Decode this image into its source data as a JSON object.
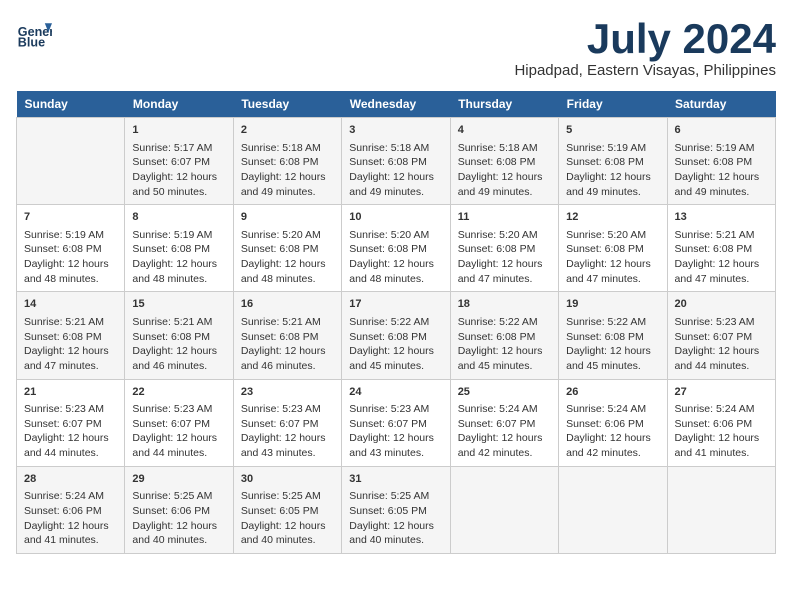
{
  "header": {
    "logo_line1": "General",
    "logo_line2": "Blue",
    "title": "July 2024",
    "subtitle": "Hipadpad, Eastern Visayas, Philippines"
  },
  "days_of_week": [
    "Sunday",
    "Monday",
    "Tuesday",
    "Wednesday",
    "Thursday",
    "Friday",
    "Saturday"
  ],
  "weeks": [
    [
      {
        "day": "",
        "content": ""
      },
      {
        "day": "1",
        "content": "Sunrise: 5:17 AM\nSunset: 6:07 PM\nDaylight: 12 hours\nand 50 minutes."
      },
      {
        "day": "2",
        "content": "Sunrise: 5:18 AM\nSunset: 6:08 PM\nDaylight: 12 hours\nand 49 minutes."
      },
      {
        "day": "3",
        "content": "Sunrise: 5:18 AM\nSunset: 6:08 PM\nDaylight: 12 hours\nand 49 minutes."
      },
      {
        "day": "4",
        "content": "Sunrise: 5:18 AM\nSunset: 6:08 PM\nDaylight: 12 hours\nand 49 minutes."
      },
      {
        "day": "5",
        "content": "Sunrise: 5:19 AM\nSunset: 6:08 PM\nDaylight: 12 hours\nand 49 minutes."
      },
      {
        "day": "6",
        "content": "Sunrise: 5:19 AM\nSunset: 6:08 PM\nDaylight: 12 hours\nand 49 minutes."
      }
    ],
    [
      {
        "day": "7",
        "content": "Sunrise: 5:19 AM\nSunset: 6:08 PM\nDaylight: 12 hours\nand 48 minutes."
      },
      {
        "day": "8",
        "content": "Sunrise: 5:19 AM\nSunset: 6:08 PM\nDaylight: 12 hours\nand 48 minutes."
      },
      {
        "day": "9",
        "content": "Sunrise: 5:20 AM\nSunset: 6:08 PM\nDaylight: 12 hours\nand 48 minutes."
      },
      {
        "day": "10",
        "content": "Sunrise: 5:20 AM\nSunset: 6:08 PM\nDaylight: 12 hours\nand 48 minutes."
      },
      {
        "day": "11",
        "content": "Sunrise: 5:20 AM\nSunset: 6:08 PM\nDaylight: 12 hours\nand 47 minutes."
      },
      {
        "day": "12",
        "content": "Sunrise: 5:20 AM\nSunset: 6:08 PM\nDaylight: 12 hours\nand 47 minutes."
      },
      {
        "day": "13",
        "content": "Sunrise: 5:21 AM\nSunset: 6:08 PM\nDaylight: 12 hours\nand 47 minutes."
      }
    ],
    [
      {
        "day": "14",
        "content": "Sunrise: 5:21 AM\nSunset: 6:08 PM\nDaylight: 12 hours\nand 47 minutes."
      },
      {
        "day": "15",
        "content": "Sunrise: 5:21 AM\nSunset: 6:08 PM\nDaylight: 12 hours\nand 46 minutes."
      },
      {
        "day": "16",
        "content": "Sunrise: 5:21 AM\nSunset: 6:08 PM\nDaylight: 12 hours\nand 46 minutes."
      },
      {
        "day": "17",
        "content": "Sunrise: 5:22 AM\nSunset: 6:08 PM\nDaylight: 12 hours\nand 45 minutes."
      },
      {
        "day": "18",
        "content": "Sunrise: 5:22 AM\nSunset: 6:08 PM\nDaylight: 12 hours\nand 45 minutes."
      },
      {
        "day": "19",
        "content": "Sunrise: 5:22 AM\nSunset: 6:08 PM\nDaylight: 12 hours\nand 45 minutes."
      },
      {
        "day": "20",
        "content": "Sunrise: 5:23 AM\nSunset: 6:07 PM\nDaylight: 12 hours\nand 44 minutes."
      }
    ],
    [
      {
        "day": "21",
        "content": "Sunrise: 5:23 AM\nSunset: 6:07 PM\nDaylight: 12 hours\nand 44 minutes."
      },
      {
        "day": "22",
        "content": "Sunrise: 5:23 AM\nSunset: 6:07 PM\nDaylight: 12 hours\nand 44 minutes."
      },
      {
        "day": "23",
        "content": "Sunrise: 5:23 AM\nSunset: 6:07 PM\nDaylight: 12 hours\nand 43 minutes."
      },
      {
        "day": "24",
        "content": "Sunrise: 5:23 AM\nSunset: 6:07 PM\nDaylight: 12 hours\nand 43 minutes."
      },
      {
        "day": "25",
        "content": "Sunrise: 5:24 AM\nSunset: 6:07 PM\nDaylight: 12 hours\nand 42 minutes."
      },
      {
        "day": "26",
        "content": "Sunrise: 5:24 AM\nSunset: 6:06 PM\nDaylight: 12 hours\nand 42 minutes."
      },
      {
        "day": "27",
        "content": "Sunrise: 5:24 AM\nSunset: 6:06 PM\nDaylight: 12 hours\nand 41 minutes."
      }
    ],
    [
      {
        "day": "28",
        "content": "Sunrise: 5:24 AM\nSunset: 6:06 PM\nDaylight: 12 hours\nand 41 minutes."
      },
      {
        "day": "29",
        "content": "Sunrise: 5:25 AM\nSunset: 6:06 PM\nDaylight: 12 hours\nand 40 minutes."
      },
      {
        "day": "30",
        "content": "Sunrise: 5:25 AM\nSunset: 6:05 PM\nDaylight: 12 hours\nand 40 minutes."
      },
      {
        "day": "31",
        "content": "Sunrise: 5:25 AM\nSunset: 6:05 PM\nDaylight: 12 hours\nand 40 minutes."
      },
      {
        "day": "",
        "content": ""
      },
      {
        "day": "",
        "content": ""
      },
      {
        "day": "",
        "content": ""
      }
    ]
  ]
}
